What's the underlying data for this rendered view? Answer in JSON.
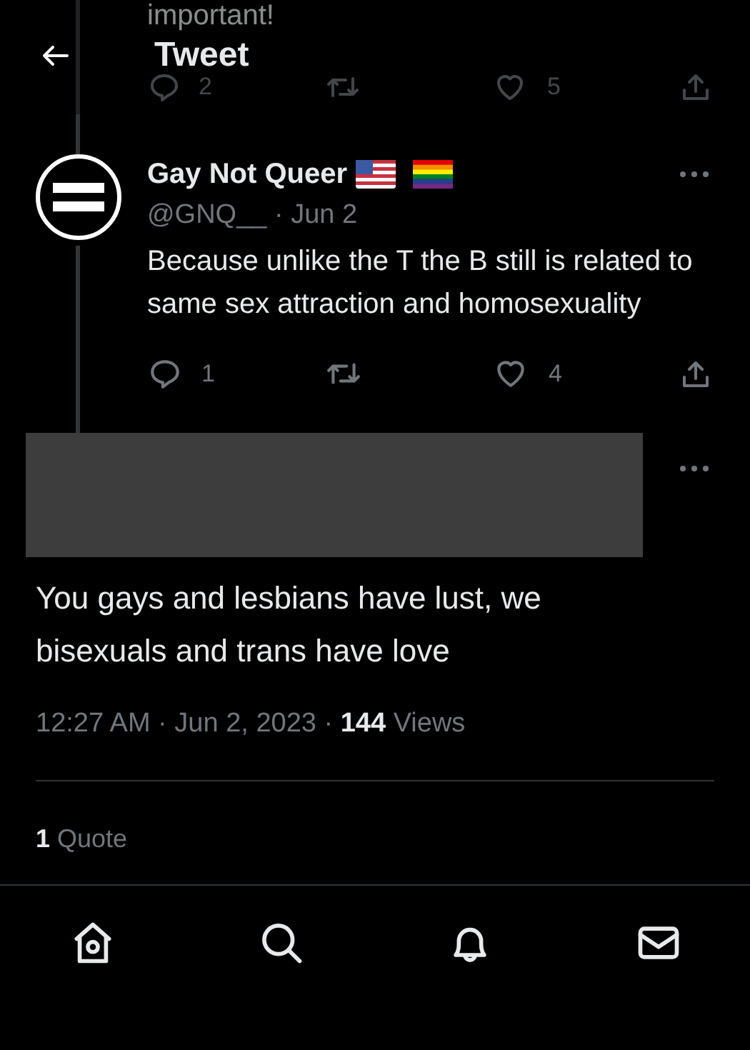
{
  "previous_tweet": {
    "text_fragment": "important!",
    "reply_count": "2",
    "like_count": "5"
  },
  "header": {
    "title": "Tweet"
  },
  "parent_tweet": {
    "author": "Gay Not Queer",
    "byline": "@GNQ__ · Jun 2",
    "text": "Because unlike the T the B still is related to same sex attraction and homosexuality",
    "reply_count": "1",
    "like_count": "4"
  },
  "main_tweet": {
    "text": "You gays and lesbians have lust, we bisexuals and trans have love",
    "meta": "12:27 AM · Jun 2, 2023 · **144** Views",
    "quotes": "**1** Quote"
  },
  "bottom_nav": [
    {
      "kind": "home"
    },
    {
      "kind": "search"
    },
    {
      "kind": "notifications"
    },
    {
      "kind": "messages"
    }
  ]
}
